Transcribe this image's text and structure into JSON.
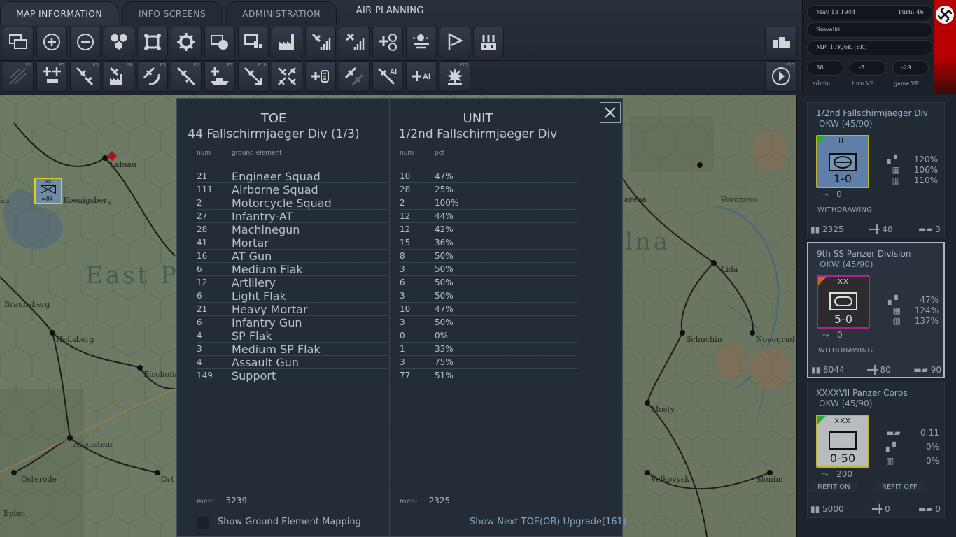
{
  "tabs": [
    {
      "label": "MAP INFORMATION",
      "active": true
    },
    {
      "label": "INFO SCREENS",
      "active": false
    },
    {
      "label": "ADMINISTRATION",
      "active": false
    },
    {
      "label": "AIR PLANNING",
      "active": false
    }
  ],
  "toolbar": {
    "row1_icons": [
      "windows-icon",
      "zoom-in-icon",
      "zoom-out-icon",
      "hex-grid-icon",
      "frame-icon",
      "gear-icon",
      "unit-display-icon",
      "monitor-icon",
      "factory-icon",
      "air-recon-icon",
      "air-strength-icon",
      "air-target-icon",
      "weather-icon",
      "flag-icon",
      "supply-depot-icon"
    ],
    "row2_icons": [
      {
        "icon": "map-overlay-icon",
        "key": "F1"
      },
      {
        "icon": "air-ground-icon",
        "key": "F2"
      },
      {
        "icon": "air-strike-icon",
        "key": "F3"
      },
      {
        "icon": "air-city-icon",
        "key": "F4"
      },
      {
        "icon": "air-recon-mission-icon",
        "key": "F5"
      },
      {
        "icon": "air-intercept-icon",
        "key": "F6"
      },
      {
        "icon": "naval-strike-icon",
        "key": "F7"
      },
      {
        "icon": "air-transfer-icon",
        "key": "F10"
      },
      {
        "icon": "air-sweep-icon",
        "key": ""
      },
      {
        "icon": "air-transport-icon",
        "key": ""
      },
      {
        "icon": "air-range-icon",
        "key": ""
      },
      {
        "icon": "ai-strike-icon",
        "key": "AI"
      },
      {
        "icon": "ai-air-icon",
        "key": "AI"
      },
      {
        "icon": "explosion-icon",
        "key": "F11"
      }
    ],
    "next_key": "F12"
  },
  "status": {
    "date": "May 13 1944",
    "turn": "Turn: 46",
    "hq": "Suwalki",
    "mp": "MP: 17K/6K (8K)",
    "admin_value": "38",
    "turn_vp_value": "-5",
    "game_vp_value": "-29",
    "admin_label": "admin",
    "turn_vp_label": "turn VP",
    "game_vp_label": "game VP"
  },
  "map": {
    "cities": [
      "Labiau",
      "au",
      "Koenigsberg",
      "Braunsberg",
      "Heilsberg",
      "Bischofs",
      "Allenstein",
      "Osterode",
      "Ort",
      "Eylau",
      "arena",
      "Voronovo",
      "Lida",
      "Schuchin",
      "Novogrud",
      "Mosty",
      "Volkovysk",
      "Slonim"
    ],
    "regions": [
      "East P",
      "lna"
    ],
    "unit_label": "=84",
    "unit_size": "xx"
  },
  "toe": {
    "left_title": "TOE",
    "left_sub": "44 Fallschirmjaeger Div (1/3)",
    "right_title": "UNIT",
    "right_sub": "1/2nd Fallschirmjaeger Div",
    "col_num": "num",
    "col_ground": "ground element",
    "col_pct": "pct",
    "rows": [
      {
        "toe_num": "21",
        "name": "Engineer Squad",
        "unit_num": "10",
        "pct": "47%"
      },
      {
        "toe_num": "111",
        "name": "Airborne Squad",
        "unit_num": "28",
        "pct": "25%"
      },
      {
        "toe_num": "2",
        "name": "Motorcycle Squad",
        "unit_num": "2",
        "pct": "100%"
      },
      {
        "toe_num": "27",
        "name": "Infantry-AT",
        "unit_num": "12",
        "pct": "44%"
      },
      {
        "toe_num": "28",
        "name": "Machinegun",
        "unit_num": "12",
        "pct": "42%"
      },
      {
        "toe_num": "41",
        "name": "Mortar",
        "unit_num": "15",
        "pct": "36%"
      },
      {
        "toe_num": "16",
        "name": "AT Gun",
        "unit_num": "8",
        "pct": "50%"
      },
      {
        "toe_num": "6",
        "name": "Medium Flak",
        "unit_num": "3",
        "pct": "50%"
      },
      {
        "toe_num": "12",
        "name": "Artillery",
        "unit_num": "6",
        "pct": "50%"
      },
      {
        "toe_num": "6",
        "name": "Light Flak",
        "unit_num": "3",
        "pct": "50%"
      },
      {
        "toe_num": "21",
        "name": "Heavy Mortar",
        "unit_num": "10",
        "pct": "47%"
      },
      {
        "toe_num": "6",
        "name": "Infantry Gun",
        "unit_num": "3",
        "pct": "50%"
      },
      {
        "toe_num": "4",
        "name": "SP Flak",
        "unit_num": "0",
        "pct": "0%"
      },
      {
        "toe_num": "3",
        "name": "Medium SP Flak",
        "unit_num": "1",
        "pct": "33%"
      },
      {
        "toe_num": "4",
        "name": "Assault Gun",
        "unit_num": "3",
        "pct": "75%"
      },
      {
        "toe_num": "149",
        "name": "Support",
        "unit_num": "77",
        "pct": "51%"
      }
    ],
    "men_label": "men:",
    "toe_men": "5239",
    "unit_men": "2325",
    "mapping_label": "Show Ground Element Mapping",
    "upgrade_link": "Show Next TOE(OB) Upgrade(161)"
  },
  "units": [
    {
      "name": "1/2nd Fallschirmjaeger Div",
      "owner": "OKW  (45/90)",
      "size": "III",
      "strength": "1-0",
      "counter_color": "#5f7fa8",
      "border_color": "#bfb52a",
      "corner_color": "#29a93a",
      "stat1": "120%",
      "stat2": "106%",
      "stat3": "110%",
      "move": "0",
      "status": "WITHDRAWING",
      "men": "2325",
      "guns": "48",
      "afv": "3"
    },
    {
      "name": "9th SS Panzer Division",
      "owner": "OKW  (45/90)",
      "size": "XX",
      "strength": "5-0",
      "counter_color": "#2b2b30",
      "border_color": "#b0238c",
      "corner_color": "#d0641a",
      "stat1": "47%",
      "stat2": "124%",
      "stat3": "137%",
      "move": "0",
      "status": "WITHDRAWING",
      "men": "8044",
      "guns": "80",
      "afv": "90"
    },
    {
      "name": "XXXXVII Panzer Corps",
      "owner": "OKW  (45/90)",
      "size": "XXX",
      "symbol": "HQ",
      "strength": "0-50",
      "counter_color": "#b9bcbe",
      "border_color": "#bfb52a",
      "corner_color": "#29a93a",
      "stat1": "0:11",
      "stat2": "0%",
      "stat3": "0%",
      "move": "200",
      "refit_on": "REFIT ON",
      "refit_off": "REFIT OFF",
      "men": "5000",
      "guns": "0",
      "afv": "0"
    }
  ]
}
